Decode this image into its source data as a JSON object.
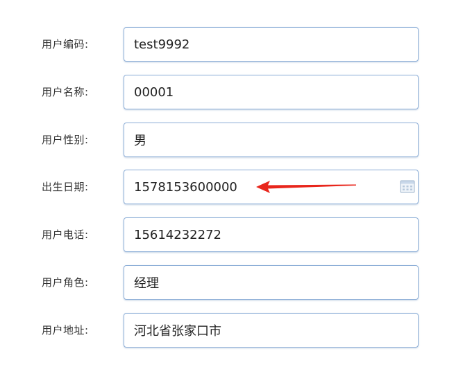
{
  "form": {
    "fields": [
      {
        "label": "用户编码:",
        "value": "test9992"
      },
      {
        "label": "用户名称:",
        "value": "00001"
      },
      {
        "label": "用户性别:",
        "value": "男"
      },
      {
        "label": "出生日期:",
        "value": "1578153600000"
      },
      {
        "label": "用户电话:",
        "value": "15614232272"
      },
      {
        "label": "用户角色:",
        "value": "经理"
      },
      {
        "label": "用户地址:",
        "value": "河北省张家口市"
      }
    ]
  },
  "icons": {
    "date_picker": "calendar-icon",
    "annotation": "red-arrow-icon"
  },
  "colors": {
    "field_border": "#8fb0d8",
    "label_text": "#333333",
    "value_text": "#222222",
    "arrow": "#e8261c"
  }
}
